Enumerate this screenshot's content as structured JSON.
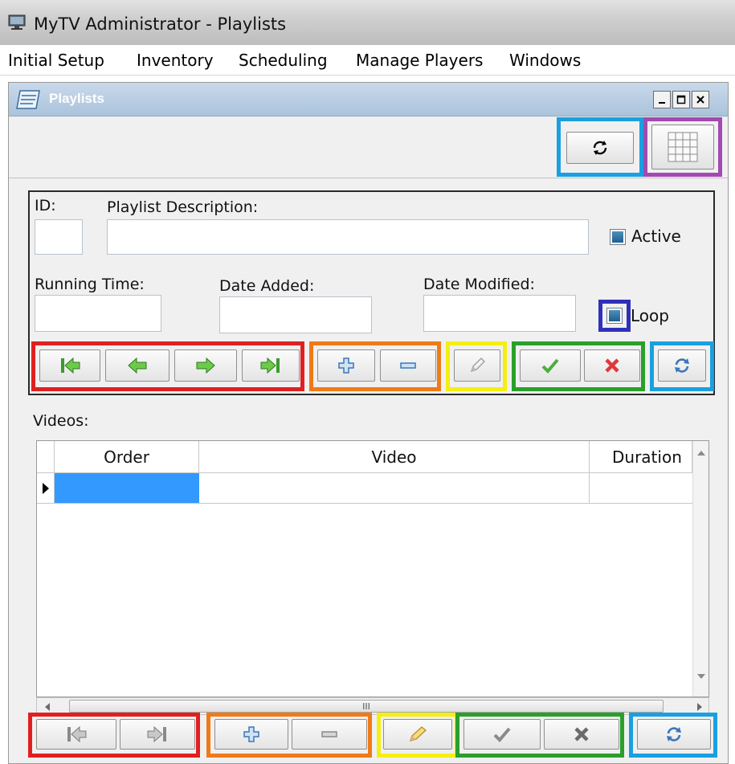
{
  "window": {
    "title": "MyTV Administrator - Playlists"
  },
  "menu": [
    "Initial Setup",
    "Inventory",
    "Scheduling",
    "Manage Players",
    "Windows"
  ],
  "child": {
    "title": "Playlists"
  },
  "form": {
    "id_label": "ID:",
    "description_label": "Playlist Description:",
    "active_label": "Active",
    "running_time_label": "Running Time:",
    "date_added_label": "Date Added:",
    "date_modified_label": "Date Modified:",
    "loop_label": "Loop",
    "id_value": "",
    "description_value": "",
    "running_time_value": "",
    "date_added_value": "",
    "date_modified_value": ""
  },
  "videos": {
    "label": "Videos:",
    "columns": [
      "Order",
      "Video",
      "Duration"
    ],
    "rows": [
      {
        "order": "",
        "video": "",
        "duration": ""
      }
    ],
    "hscroll_glyph": "III"
  },
  "colors": {
    "nav_group": "#e02020",
    "add_remove_group": "#f07a18",
    "edit_group": "#f5ee12",
    "save_cancel_group": "#2aa02a",
    "refresh_group": "#1aa0e0",
    "grid_button": "#a24ab0",
    "loop_checkbox": "#3030b8"
  }
}
